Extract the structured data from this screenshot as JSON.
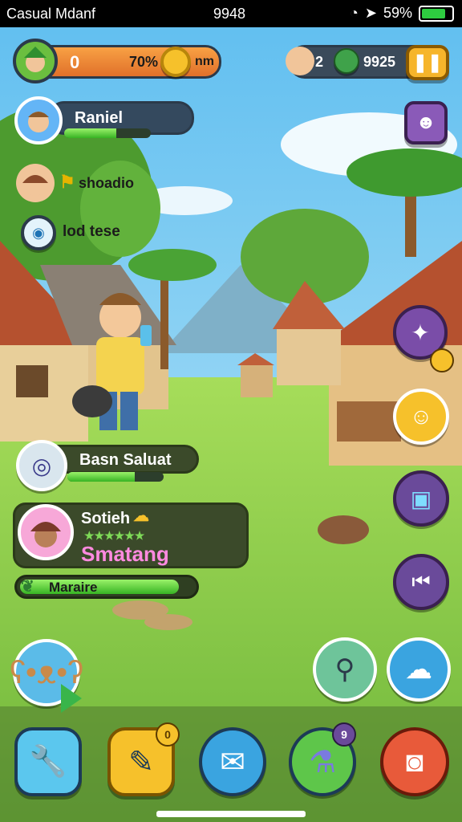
{
  "status": {
    "carrier": "Casual Mdanf",
    "time": "9948",
    "battery": "59%",
    "battery_level": 0.9
  },
  "topbar": {
    "currency_value": "0",
    "percent": "70%",
    "unit": "nm",
    "friends_count": "2",
    "gems": "9925",
    "pause_icon": "pause-icon"
  },
  "players": [
    {
      "name": "Raniel",
      "progress": 0.6
    },
    {
      "name": "shoadio",
      "progress": null
    },
    {
      "name": "lod tese",
      "progress": null
    }
  ],
  "mid_panel": {
    "title": "Basn Saluat",
    "progress": 0.7
  },
  "profile_card": {
    "name": "Sotieh",
    "rating_text": "★★★★★★",
    "status": "Smatang"
  },
  "meter": {
    "label": "Maraire",
    "progress": 0.9
  },
  "colors": {
    "sky": "#8fd3f5",
    "grass": "#8bd14b",
    "accent": "#f6a623",
    "panel": "#3b4a2a"
  },
  "bottom_nav": [
    {
      "name": "wrench-icon"
    },
    {
      "name": "chat-icon",
      "badge": "0"
    },
    {
      "name": "speech-icon"
    },
    {
      "name": "potion-icon",
      "badge": "9"
    },
    {
      "name": "camera-icon"
    }
  ]
}
